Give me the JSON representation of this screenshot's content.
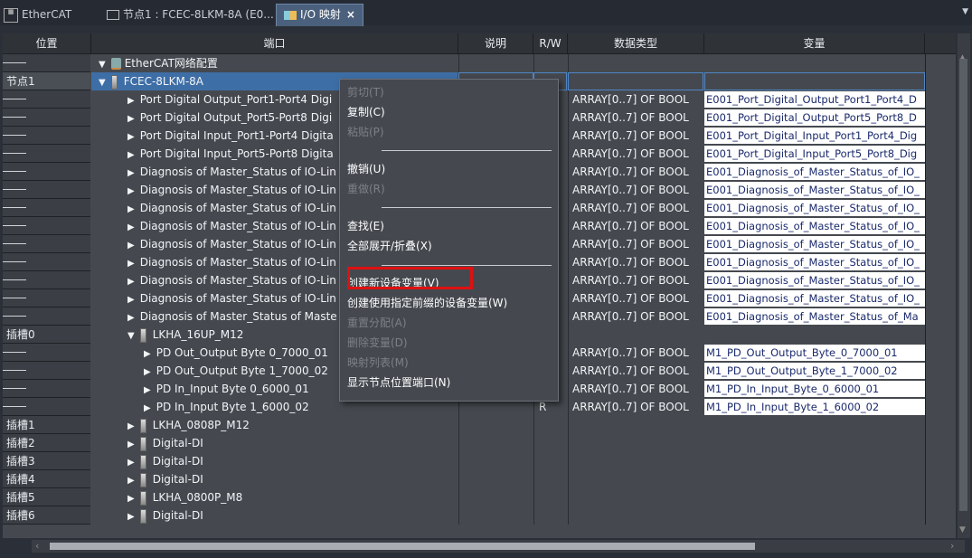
{
  "tabs": [
    {
      "label": "EtherCAT",
      "icon": "ethercat-icon"
    },
    {
      "label": "节点1 : FCEC-8LKM-8A (E0...",
      "icon": "node-icon"
    },
    {
      "label": "I/O 映射",
      "icon": "io-map-icon",
      "close": "×"
    }
  ],
  "columns": {
    "position": "位置",
    "port": "端口",
    "description": "说明",
    "rw": "R/W",
    "datatype": "数据类型",
    "variable": "变量"
  },
  "rows": [
    {
      "pos": "",
      "port": "EtherCAT网络配置",
      "rw": "",
      "dtype": "",
      "var": ""
    },
    {
      "pos": "节点1",
      "port": "FCEC-8LKM-8A",
      "rw": "",
      "dtype": "",
      "var": ""
    },
    {
      "pos": "",
      "port": "Port Digital Output_Port1-Port4 Digi",
      "rw": "",
      "dtype": "ARRAY[0..7] OF BOOL",
      "var": "E001_Port_Digital_Output_Port1_Port4_D"
    },
    {
      "pos": "",
      "port": "Port Digital Output_Port5-Port8 Digi",
      "rw": "",
      "dtype": "ARRAY[0..7] OF BOOL",
      "var": "E001_Port_Digital_Output_Port5_Port8_D"
    },
    {
      "pos": "",
      "port": "Port Digital Input_Port1-Port4 Digita",
      "rw": "",
      "dtype": "ARRAY[0..7] OF BOOL",
      "var": "E001_Port_Digital_Input_Port1_Port4_Dig"
    },
    {
      "pos": "",
      "port": "Port Digital Input_Port5-Port8 Digita",
      "rw": "",
      "dtype": "ARRAY[0..7] OF BOOL",
      "var": "E001_Port_Digital_Input_Port5_Port8_Dig"
    },
    {
      "pos": "",
      "port": "Diagnosis of Master_Status of IO-Lin",
      "rw": "",
      "dtype": "ARRAY[0..7] OF BOOL",
      "var": "E001_Diagnosis_of_Master_Status_of_IO_"
    },
    {
      "pos": "",
      "port": "Diagnosis of Master_Status of IO-Lin",
      "rw": "",
      "dtype": "ARRAY[0..7] OF BOOL",
      "var": "E001_Diagnosis_of_Master_Status_of_IO_"
    },
    {
      "pos": "",
      "port": "Diagnosis of Master_Status of IO-Lin",
      "rw": "",
      "dtype": "ARRAY[0..7] OF BOOL",
      "var": "E001_Diagnosis_of_Master_Status_of_IO_"
    },
    {
      "pos": "",
      "port": "Diagnosis of Master_Status of IO-Lin",
      "rw": "",
      "dtype": "ARRAY[0..7] OF BOOL",
      "var": "E001_Diagnosis_of_Master_Status_of_IO_"
    },
    {
      "pos": "",
      "port": "Diagnosis of Master_Status of IO-Lin",
      "rw": "",
      "dtype": "ARRAY[0..7] OF BOOL",
      "var": "E001_Diagnosis_of_Master_Status_of_IO_"
    },
    {
      "pos": "",
      "port": "Diagnosis of Master_Status of IO-Lin",
      "rw": "",
      "dtype": "ARRAY[0..7] OF BOOL",
      "var": "E001_Diagnosis_of_Master_Status_of_IO_"
    },
    {
      "pos": "",
      "port": "Diagnosis of Master_Status of IO-Lin",
      "rw": "",
      "dtype": "ARRAY[0..7] OF BOOL",
      "var": "E001_Diagnosis_of_Master_Status_of_IO_"
    },
    {
      "pos": "",
      "port": "Diagnosis of Master_Status of IO-Lin",
      "rw": "",
      "dtype": "ARRAY[0..7] OF BOOL",
      "var": "E001_Diagnosis_of_Master_Status_of_IO_"
    },
    {
      "pos": "",
      "port": "Diagnosis of Master_Status of Maste",
      "rw": "",
      "dtype": "ARRAY[0..7] OF BOOL",
      "var": "E001_Diagnosis_of_Master_Status_of_Ma"
    },
    {
      "pos": "插槽0",
      "port": "LKHA_16UP_M12",
      "rw": "",
      "dtype": "",
      "var": ""
    },
    {
      "pos": "",
      "port": "PD Out_Output Byte 0_7000_01",
      "rw": "",
      "dtype": "ARRAY[0..7] OF BOOL",
      "var": "M1_PD_Out_Output_Byte_0_7000_01"
    },
    {
      "pos": "",
      "port": "PD Out_Output Byte 1_7000_02",
      "rw": "",
      "dtype": "ARRAY[0..7] OF BOOL",
      "var": "M1_PD_Out_Output_Byte_1_7000_02"
    },
    {
      "pos": "",
      "port": "PD In_Input Byte 0_6000_01",
      "rw": "R",
      "dtype": "ARRAY[0..7] OF BOOL",
      "var": "M1_PD_In_Input_Byte_0_6000_01"
    },
    {
      "pos": "",
      "port": "PD In_Input Byte 1_6000_02",
      "rw": "R",
      "dtype": "ARRAY[0..7] OF BOOL",
      "var": "M1_PD_In_Input_Byte_1_6000_02"
    },
    {
      "pos": "插槽1",
      "port": "LKHA_0808P_M12",
      "rw": "",
      "dtype": "",
      "var": ""
    },
    {
      "pos": "插槽2",
      "port": "Digital-DI",
      "rw": "",
      "dtype": "",
      "var": ""
    },
    {
      "pos": "插槽3",
      "port": "Digital-DI",
      "rw": "",
      "dtype": "",
      "var": ""
    },
    {
      "pos": "插槽4",
      "port": "Digital-DI",
      "rw": "",
      "dtype": "",
      "var": ""
    },
    {
      "pos": "插槽5",
      "port": "LKHA_0800P_M8",
      "rw": "",
      "dtype": "",
      "var": ""
    },
    {
      "pos": "插槽6",
      "port": "Digital-DI",
      "rw": "",
      "dtype": "",
      "var": ""
    }
  ],
  "context_menu": {
    "cut": "剪切(T)",
    "copy": "复制(C)",
    "paste": "粘贴(P)",
    "undo": "撤销(U)",
    "redo": "重做(R)",
    "find": "查找(E)",
    "expand_collapse": "全部展开/折叠(X)",
    "create_device_var": "创建新设备变量(V)",
    "create_with_prefix": "创建使用指定前缀的设备变量(W)",
    "reassign": "重置分配(A)",
    "delete_var": "删除变量(D)",
    "map_list": "映射列表(M)",
    "show_node_port": "显示节点位置端口(N)"
  },
  "colors": {
    "highlight_box": "#e01010",
    "selection": "#3e6ea6",
    "background": "#45494f"
  }
}
